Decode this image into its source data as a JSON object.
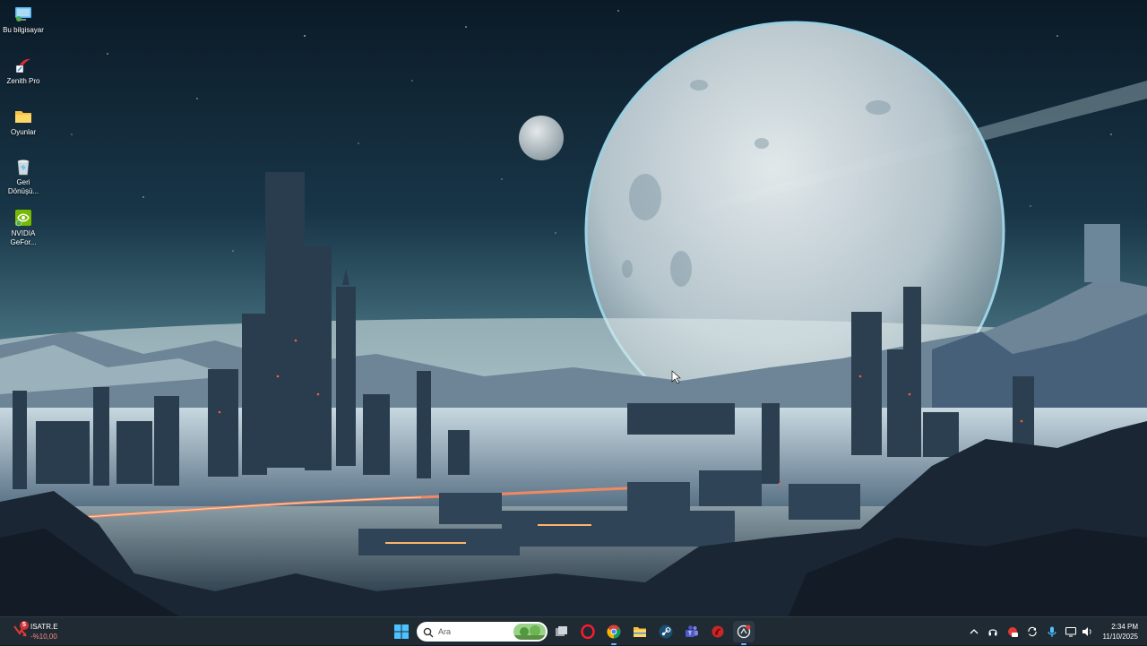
{
  "desktop": {
    "icons": [
      {
        "label": "Bu bilgisayar",
        "icon": "this-pc-icon"
      },
      {
        "label": "Zenith Pro",
        "icon": "zenith-pro-icon"
      },
      {
        "label": "Oyunlar",
        "icon": "folder-icon"
      },
      {
        "label": "Geri Dönüşü...",
        "icon": "recycle-bin-icon"
      },
      {
        "label": "NVIDIA GeFor...",
        "icon": "nvidia-icon"
      }
    ]
  },
  "taskbar": {
    "weather": {
      "badge": "5",
      "name": "ISATR.E",
      "change": "-%10,00"
    },
    "search": {
      "placeholder": "Ara"
    },
    "apps": [
      "start-icon",
      "task-view-icon",
      "opera-icon",
      "chrome-icon",
      "file-explorer-icon",
      "steam-icon",
      "teams-icon",
      "red-app-icon",
      "active-app-icon"
    ],
    "tray": {
      "time": "2:34 PM",
      "date": "11/10/2025"
    }
  },
  "colors": {
    "taskbar": "#1f2a33",
    "accent": "#6cb8ff",
    "alert": "#d13438"
  }
}
